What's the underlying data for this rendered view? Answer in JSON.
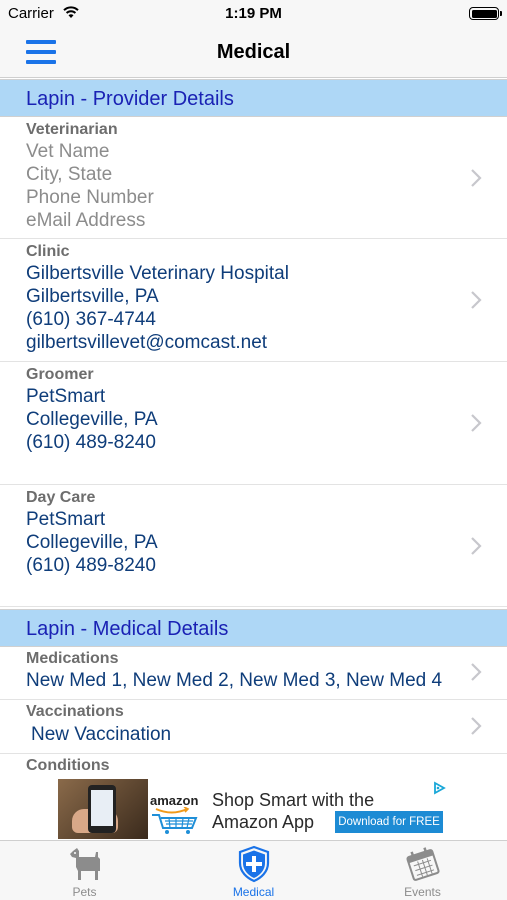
{
  "status_bar": {
    "carrier": "Carrier",
    "time": "1:19 PM"
  },
  "nav": {
    "title": "Medical"
  },
  "provider_section": {
    "title": "Lapin - Provider Details"
  },
  "veterinarian": {
    "label": "Veterinarian",
    "name": "Vet Name",
    "location": "City, State",
    "phone": "Phone Number",
    "email": "eMail Address"
  },
  "clinic": {
    "label": "Clinic",
    "name": "Gilbertsville Veterinary Hospital",
    "location": "Gilbertsville, PA",
    "phone": "(610) 367-4744",
    "email": "gilbertsvillevet@comcast.net"
  },
  "groomer": {
    "label": "Groomer",
    "name": "PetSmart",
    "location": "Collegeville, PA",
    "phone": "(610) 489-8240"
  },
  "daycare": {
    "label": "Day Care",
    "name": "PetSmart",
    "location": "Collegeville, PA",
    "phone": "(610) 489-8240"
  },
  "medical_section": {
    "title": "Lapin - Medical Details"
  },
  "medications": {
    "label": "Medications",
    "value": "New Med 1, New Med 2, New Med 3, New Med 4"
  },
  "vaccinations": {
    "label": "Vaccinations",
    "value": "New Vaccination"
  },
  "conditions": {
    "label": "Conditions"
  },
  "ad": {
    "brand": "amazon",
    "headline_1": "Shop Smart with the",
    "headline_2": "Amazon App",
    "button": "Download for FREE"
  },
  "tabs": [
    {
      "label": "Pets",
      "icon": "dog-icon",
      "active": false
    },
    {
      "label": "Medical",
      "icon": "medical-shield-icon",
      "active": true
    },
    {
      "label": "Events",
      "icon": "calendar-icon",
      "active": false
    }
  ],
  "colors": {
    "accent": "#1a73e8",
    "section_header_bg": "#aed7f6",
    "section_header_text": "#1a22b4",
    "value_text": "#0f3d7a",
    "placeholder_text": "#8c8c8c"
  }
}
